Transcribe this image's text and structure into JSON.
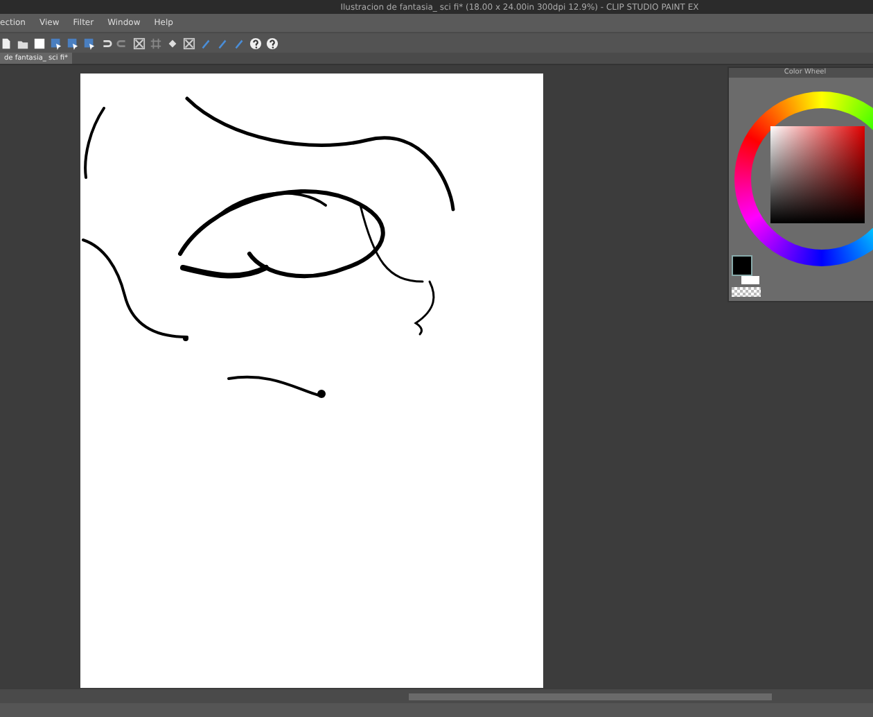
{
  "window": {
    "title": "Ilustracion de fantasia_ sci fi* (18.00 x 24.00in 300dpi 12.9%)  - CLIP STUDIO PAINT EX"
  },
  "menu": [
    "ection",
    "View",
    "Filter",
    "Window",
    "Help"
  ],
  "toolbar": [
    {
      "kind": "page"
    },
    {
      "kind": "save"
    },
    {
      "kind": "square"
    },
    {
      "kind": "select"
    },
    {
      "kind": "select"
    },
    {
      "kind": "select"
    },
    {
      "kind": "undo"
    },
    {
      "kind": "redo"
    },
    {
      "kind": "transform"
    },
    {
      "kind": "grid"
    },
    {
      "kind": "fill"
    },
    {
      "kind": "transform"
    },
    {
      "kind": "pen"
    },
    {
      "kind": "pen"
    },
    {
      "kind": "pen"
    },
    {
      "kind": "help"
    },
    {
      "kind": "help"
    }
  ],
  "tabs": [
    {
      "label": "de fantasia_ sci fi*",
      "selected": true
    }
  ],
  "color_wheel": {
    "title": "Color Wheel",
    "swatches": [
      {
        "color": "#000000"
      },
      {
        "color": "#ffffff"
      }
    ]
  }
}
